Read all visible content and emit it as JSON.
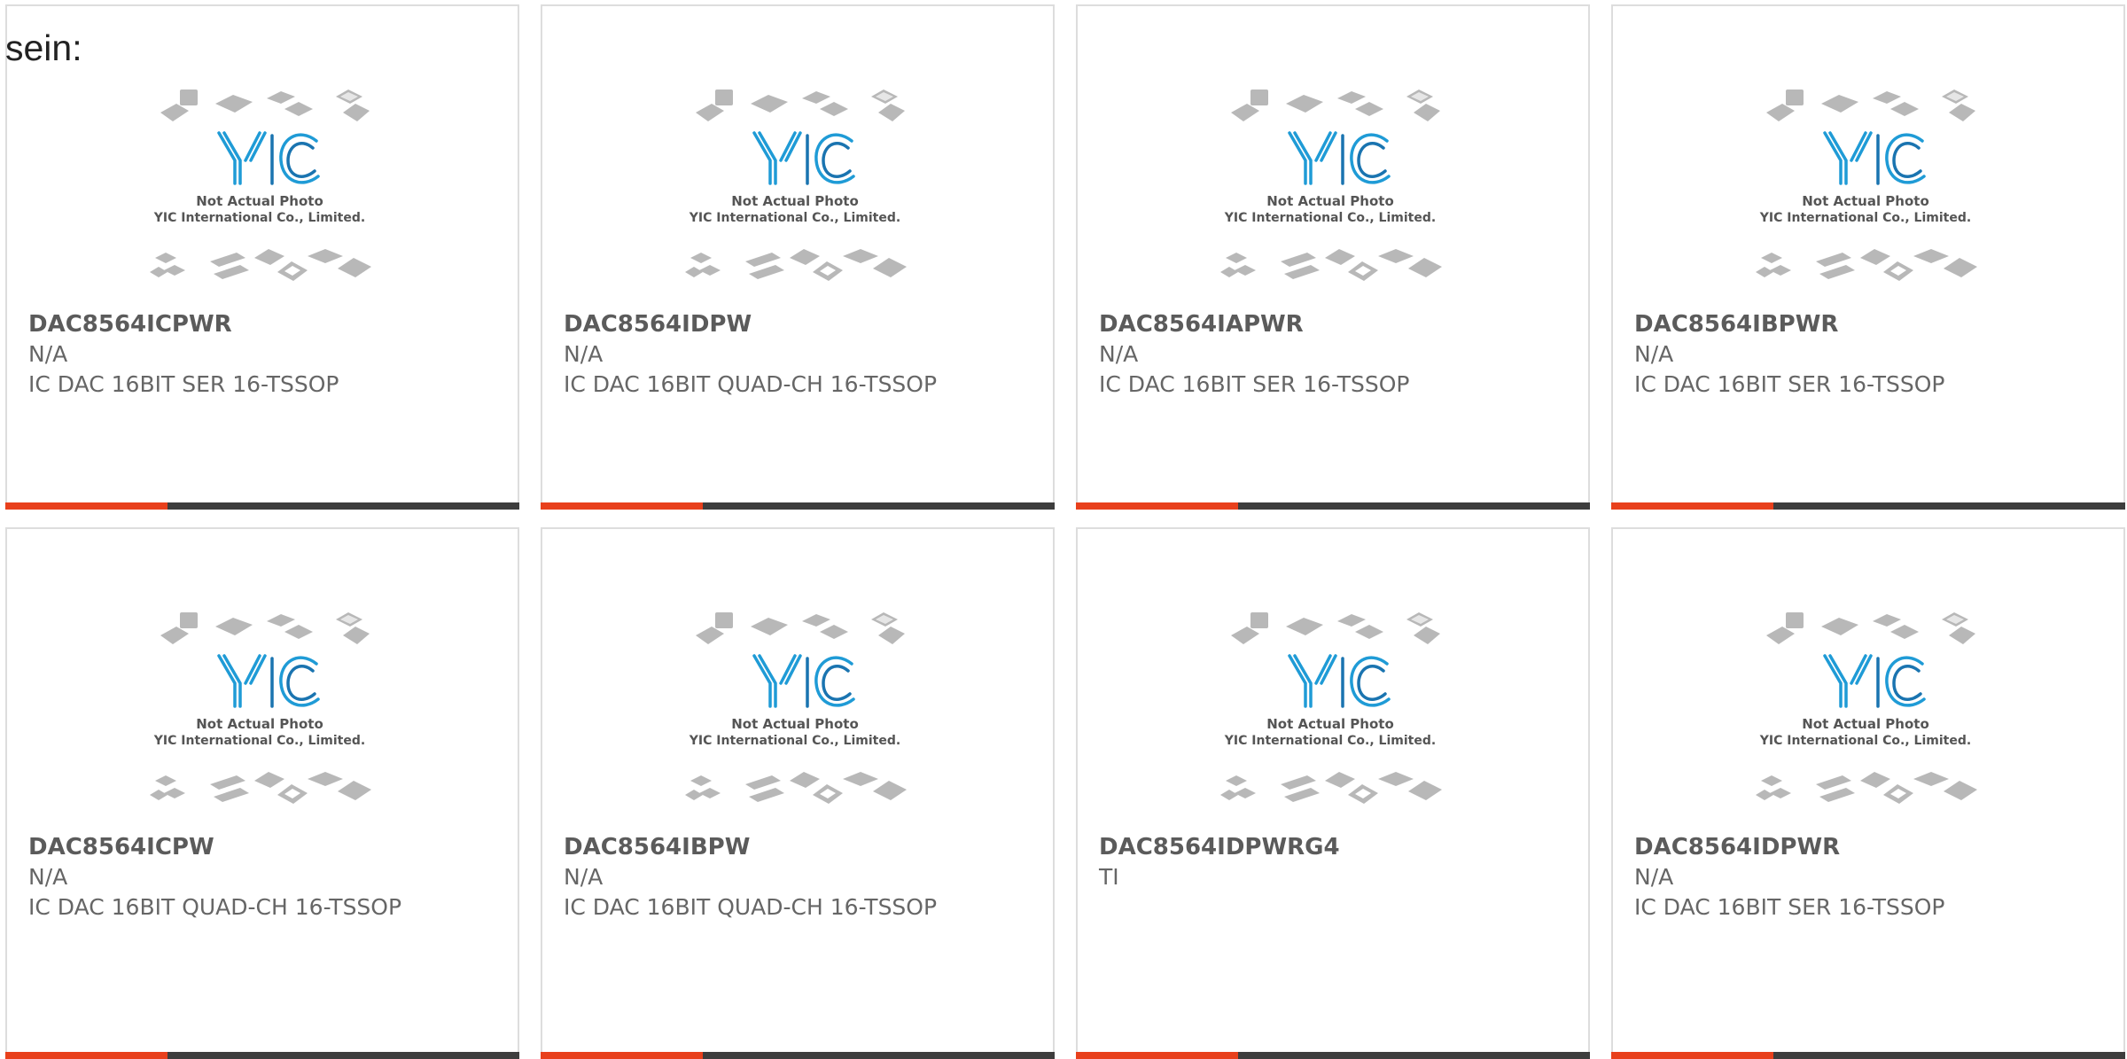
{
  "heading": "sein:",
  "colors": {
    "accent": "#e8401c",
    "bar": "#3d3d3d",
    "logo_blue": "#1f9bd6",
    "text_gray": "#666666"
  },
  "placeholder": {
    "line1": "Not Actual Photo",
    "line2": "YIC International Co., Limited.",
    "logo_text": "YIC"
  },
  "products": [
    {
      "part": "DAC8564ICPWR",
      "mfr": "N/A",
      "desc": "IC DAC 16BIT SER 16-TSSOP"
    },
    {
      "part": "DAC8564IDPW",
      "mfr": "N/A",
      "desc": "IC DAC 16BIT QUAD-CH 16-TSSOP"
    },
    {
      "part": "DAC8564IAPWR",
      "mfr": "N/A",
      "desc": "IC DAC 16BIT SER 16-TSSOP"
    },
    {
      "part": "DAC8564IBPWR",
      "mfr": "N/A",
      "desc": "IC DAC 16BIT SER 16-TSSOP"
    },
    {
      "part": "DAC8564ICPW",
      "mfr": "N/A",
      "desc": "IC DAC 16BIT QUAD-CH 16-TSSOP"
    },
    {
      "part": "DAC8564IBPW",
      "mfr": "N/A",
      "desc": "IC DAC 16BIT QUAD-CH 16-TSSOP"
    },
    {
      "part": "DAC8564IDPWRG4",
      "mfr": "TI",
      "desc": ""
    },
    {
      "part": "DAC8564IDPWR",
      "mfr": "N/A",
      "desc": "IC DAC 16BIT SER 16-TSSOP"
    }
  ]
}
